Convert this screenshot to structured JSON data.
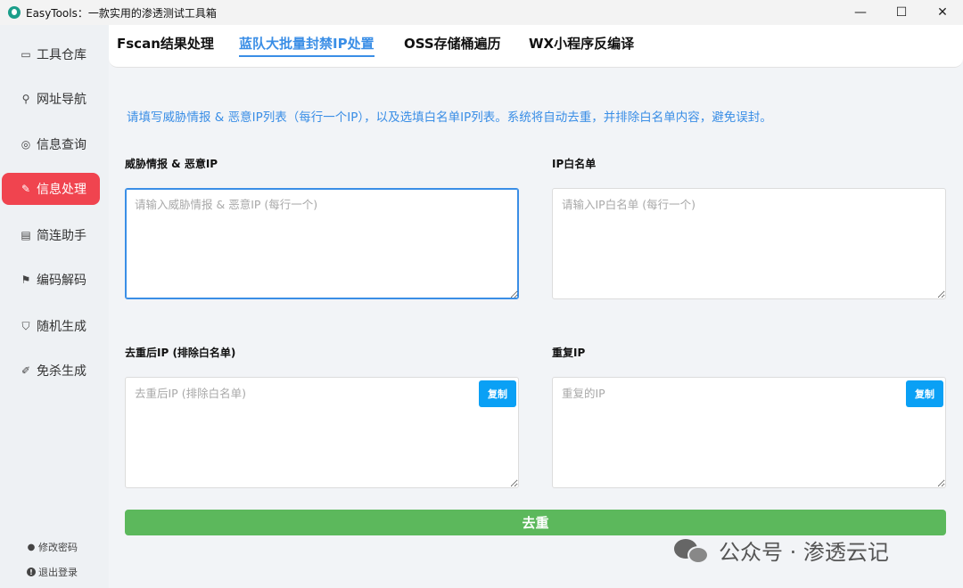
{
  "window": {
    "title": "EasyTools：一款实用的渗透测试工具箱",
    "minimize_glyph": "—",
    "maximize_glyph": "☐",
    "close_glyph": "✕"
  },
  "sidebar": {
    "items": [
      {
        "label": "工具仓库",
        "icon": "box-icon",
        "glyph": "▭"
      },
      {
        "label": "网址导航",
        "icon": "link-icon",
        "glyph": "⚲"
      },
      {
        "label": "信息查询",
        "icon": "query-icon",
        "glyph": "◎"
      },
      {
        "label": "信息处理",
        "icon": "edit-icon",
        "glyph": "✎",
        "active": true
      },
      {
        "label": "简连助手",
        "icon": "calendar-icon",
        "glyph": "▤"
      },
      {
        "label": "编码解码",
        "icon": "flag-icon",
        "glyph": "⚑"
      },
      {
        "label": "随机生成",
        "icon": "shield-icon",
        "glyph": "⛉"
      },
      {
        "label": "免杀生成",
        "icon": "pen-icon",
        "glyph": "✐"
      }
    ],
    "footer": {
      "change_password": "修改密码",
      "logout": "退出登录",
      "user_glyph": "●",
      "logout_glyph": "!"
    }
  },
  "tabs": [
    {
      "label": "Fscan结果处理"
    },
    {
      "label": "蓝队大批量封禁IP处置",
      "active": true
    },
    {
      "label": "OSS存储桶遍历"
    },
    {
      "label": "WX小程序反编译"
    }
  ],
  "panel": {
    "hint": "请填写威胁情报 & 恶意IP列表（每行一个IP），以及选填白名单IP列表。系统将自动去重，并排除白名单内容，避免误封。",
    "threat": {
      "label": "威胁情报 & 恶意IP",
      "placeholder": "请输入威胁情报 & 恶意IP (每行一个)"
    },
    "whitelist": {
      "label": "IP白名单",
      "placeholder": "请输入IP白名单 (每行一个)"
    },
    "deduped": {
      "label": "去重后IP (排除白名单)",
      "placeholder": "去重后IP (排除白名单)",
      "copy_label": "复制"
    },
    "duplicates": {
      "label": "重复IP",
      "placeholder": "重复的IP",
      "copy_label": "复制"
    },
    "dedupe_button": "去重"
  },
  "watermark": {
    "text": "公众号 · 渗透云记"
  },
  "colors": {
    "accent": "#3a8ee6",
    "active_nav": "#f0444f",
    "copy_button": "#0aa0f5",
    "dedupe_button": "#5cb85c"
  }
}
